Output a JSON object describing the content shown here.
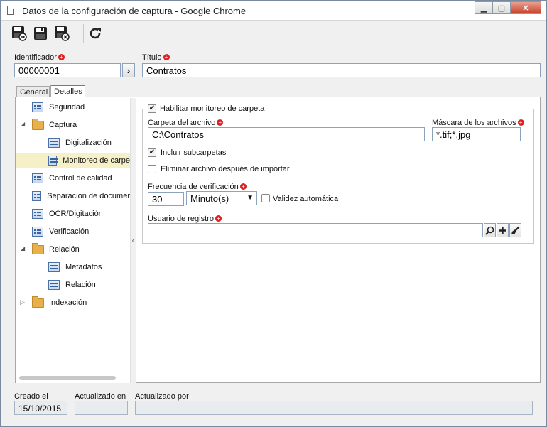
{
  "window": {
    "title": "Datos de la configuración de captura - Google Chrome",
    "minimize_icon": "minimize-icon",
    "maximize_icon": "maximize-icon",
    "close_icon": "close-icon"
  },
  "toolbar": {
    "icons": [
      "save-and-new-icon",
      "save-icon",
      "save-and-close-icon",
      "refresh-icon"
    ]
  },
  "header": {
    "identificador_label": "Identificador",
    "identificador_value": "00000001",
    "titulo_label": "Título",
    "titulo_value": "Contratos"
  },
  "tabs": [
    {
      "label": "General",
      "active": false
    },
    {
      "label": "Detalles",
      "active": true
    }
  ],
  "tree": {
    "items": [
      {
        "label": "Seguridad",
        "icon": "page-icon",
        "level": 0
      },
      {
        "label": "Captura",
        "icon": "folder-open-icon",
        "level": 0,
        "expanded": true
      },
      {
        "label": "Digitalización",
        "icon": "page-icon",
        "level": 1
      },
      {
        "label": "Monitoreo de carpe",
        "icon": "page-icon",
        "level": 1,
        "selected": true
      },
      {
        "label": "Control de calidad",
        "icon": "page-icon",
        "level": 0
      },
      {
        "label": "Separación de documer",
        "icon": "page-icon",
        "level": 0
      },
      {
        "label": "OCR/Digitación",
        "icon": "page-icon",
        "level": 0
      },
      {
        "label": "Verificación",
        "icon": "page-icon",
        "level": 0
      },
      {
        "label": "Relación",
        "icon": "folder-open-icon",
        "level": 0,
        "expanded": true
      },
      {
        "label": "Metadatos",
        "icon": "page-icon",
        "level": 1
      },
      {
        "label": "Relación",
        "icon": "page-icon",
        "level": 1
      },
      {
        "label": "Indexación",
        "icon": "folder-icon",
        "level": 0,
        "expanded": false
      }
    ]
  },
  "form": {
    "habilitar_label": "Habilitar monitoreo de carpeta",
    "habilitar_checked": true,
    "carpeta_label": "Carpeta del archivo",
    "carpeta_value": "C:\\Contratos",
    "mascara_label": "Máscara de los archivos",
    "mascara_value": "*.tif;*.jpg",
    "incluir_label": "Incluir subcarpetas",
    "incluir_checked": true,
    "eliminar_label": "Eliminar archivo después de importar",
    "eliminar_checked": false,
    "frecuencia_label": "Frecuencia de verificación",
    "frecuencia_value": "30",
    "frecuencia_unit": "Minuto(s)",
    "validez_label": "Validez automática",
    "validez_checked": false,
    "usuario_label": "Usuario de registro",
    "usuario_value": ""
  },
  "footer": {
    "creado_label": "Creado el",
    "creado_value": "15/10/2015",
    "actualizado_en_label": "Actualizado en",
    "actualizado_en_value": "",
    "actualizado_por_label": "Actualizado por",
    "actualizado_por_value": ""
  }
}
